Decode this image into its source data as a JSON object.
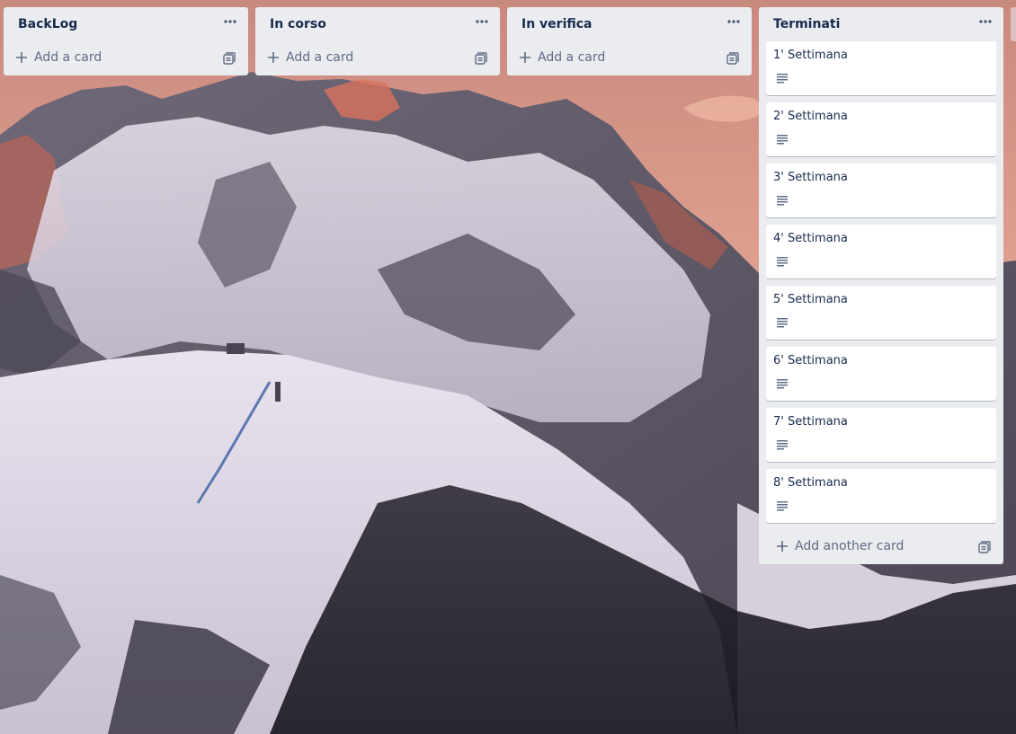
{
  "colors": {
    "list_bg": "#ebecf0",
    "card_bg": "#ffffff",
    "title_text": "#172b4d",
    "muted_text": "#5e6c84"
  },
  "lists": [
    {
      "title": "BackLog",
      "menu_icon": "ellipsis-icon",
      "add_label": "Add a card",
      "cards": []
    },
    {
      "title": "In corso",
      "menu_icon": "ellipsis-icon",
      "add_label": "Add a card",
      "cards": []
    },
    {
      "title": "In verifica",
      "menu_icon": "ellipsis-icon",
      "add_label": "Add a card",
      "cards": []
    },
    {
      "title": "Terminati",
      "menu_icon": "ellipsis-icon",
      "add_label": "Add another card",
      "cards": [
        {
          "title": "1' Settimana",
          "has_description": true
        },
        {
          "title": "2' Settimana",
          "has_description": true
        },
        {
          "title": "3' Settimana",
          "has_description": true
        },
        {
          "title": "4' Settimana",
          "has_description": true
        },
        {
          "title": "5' Settimana",
          "has_description": true
        },
        {
          "title": "6' Settimana",
          "has_description": true
        },
        {
          "title": "7' Settimana",
          "has_description": true
        },
        {
          "title": "8' Settimana",
          "has_description": true
        }
      ]
    }
  ]
}
